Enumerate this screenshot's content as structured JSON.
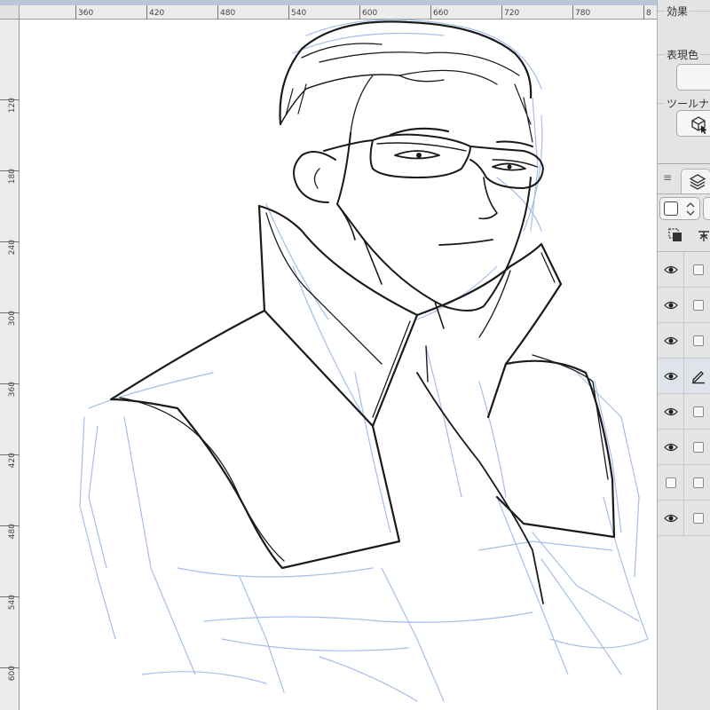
{
  "ruler": {
    "top_labels": [
      "360",
      "420",
      "480",
      "540",
      "600",
      "660",
      "720",
      "780",
      "8"
    ],
    "left_labels": [
      "120",
      "180",
      "240",
      "300",
      "360",
      "420",
      "480",
      "540",
      "600"
    ]
  },
  "panel": {
    "effect_label": "効果",
    "expression_color_label": "表現色",
    "tool_navigator_label": "ツールナ",
    "layers": [
      {
        "visible": true,
        "icon": "eye-icon"
      },
      {
        "visible": true,
        "icon": "eye-icon"
      },
      {
        "visible": true,
        "icon": "eye-icon"
      },
      {
        "visible": true,
        "icon": "eye-icon",
        "active": true,
        "editing_icon": "pen-icon"
      },
      {
        "visible": true,
        "icon": "eye-icon"
      },
      {
        "visible": true,
        "icon": "eye-icon"
      },
      {
        "visible": false,
        "icon": "checkbox-icon"
      },
      {
        "visible": true,
        "icon": "eye-icon"
      }
    ]
  },
  "colors": {
    "sketch_blue": "#9cb8e6",
    "ink": "#1a1a1a",
    "canvas": "#ffffff",
    "panel_bg": "#e4e4e4"
  },
  "canvas": {
    "artwork": "man-with-glasses-high-collar-line-art"
  }
}
